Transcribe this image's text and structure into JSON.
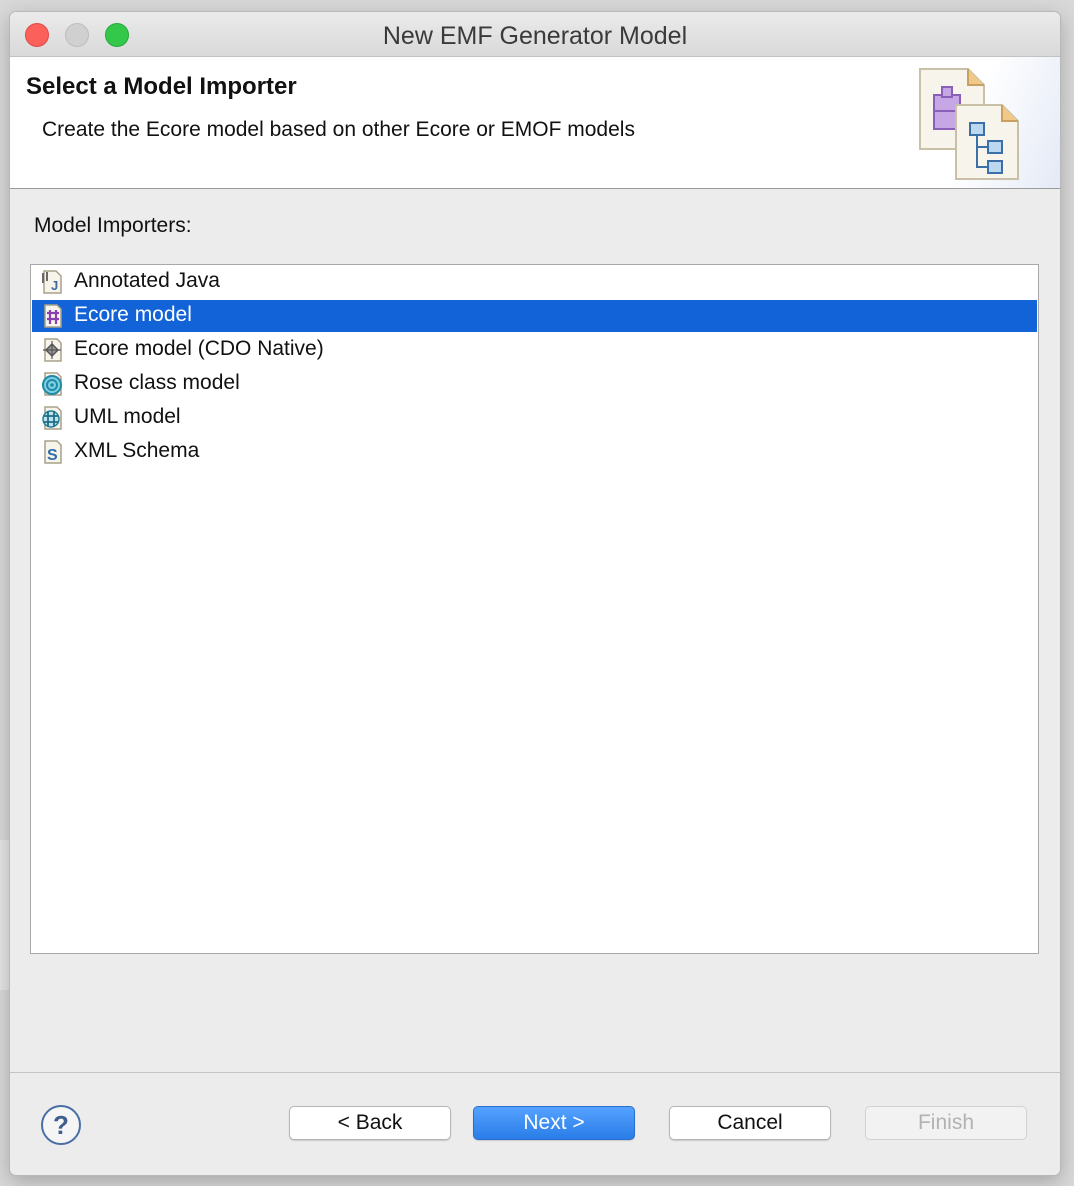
{
  "window": {
    "title": "New EMF Generator Model"
  },
  "header": {
    "title": "Select a Model Importer",
    "description": "Create the Ecore model based on other Ecore or EMOF models",
    "banner_icon": "model-importer-wizard-icon"
  },
  "importers": {
    "label": "Model Importers:",
    "selected": "Ecore model",
    "items": [
      {
        "label": "Annotated Java",
        "icon": "java-file-icon"
      },
      {
        "label": "Ecore model",
        "icon": "ecore-model-icon"
      },
      {
        "label": "Ecore model (CDO Native)",
        "icon": "cdo-model-icon"
      },
      {
        "label": "Rose class model",
        "icon": "rose-model-icon"
      },
      {
        "label": "UML model",
        "icon": "uml-model-icon"
      },
      {
        "label": "XML Schema",
        "icon": "xml-schema-icon"
      }
    ]
  },
  "buttons": {
    "help": "?",
    "back": "< Back",
    "next": "Next >",
    "cancel": "Cancel",
    "finish": "Finish"
  },
  "colors": {
    "selection": "#1263d8",
    "next_button": "#2a7de8",
    "close": "#fc605b",
    "maximize": "#34c84a"
  }
}
